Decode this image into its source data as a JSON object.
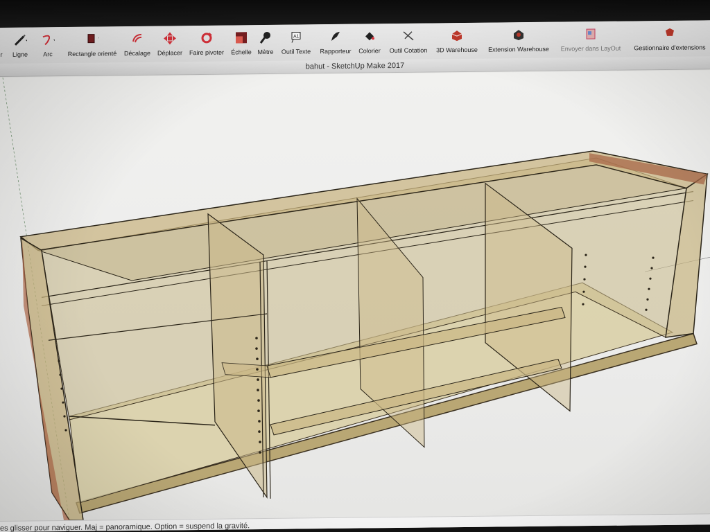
{
  "app": {
    "window_title": "bahut - SketchUp Make 2017"
  },
  "toolbar": {
    "tools": [
      {
        "id": "select",
        "label": "r",
        "icon": "select-arrow-icon"
      },
      {
        "id": "line",
        "label": "Ligne",
        "icon": "pencil-icon"
      },
      {
        "id": "arc",
        "label": "Arc",
        "icon": "arc-icon"
      },
      {
        "id": "rotated-rectangle",
        "label": "Rectangle orienté",
        "icon": "rotated-rectangle-icon"
      },
      {
        "id": "offset",
        "label": "Décalage",
        "icon": "offset-icon"
      },
      {
        "id": "move",
        "label": "Déplacer",
        "icon": "move-icon"
      },
      {
        "id": "rotate",
        "label": "Faire pivoter",
        "icon": "rotate-icon"
      },
      {
        "id": "scale",
        "label": "Échelle",
        "icon": "scale-icon"
      },
      {
        "id": "tape",
        "label": "Mètre",
        "icon": "tape-measure-icon"
      },
      {
        "id": "text",
        "label": "Outil Texte",
        "icon": "text-tool-icon"
      },
      {
        "id": "protractor",
        "label": "Rapporteur",
        "icon": "protractor-icon"
      },
      {
        "id": "paint",
        "label": "Colorier",
        "icon": "paint-bucket-icon"
      },
      {
        "id": "dimension",
        "label": "Outil Cotation",
        "icon": "dimension-icon"
      },
      {
        "id": "3d-warehouse",
        "label": "3D Warehouse",
        "icon": "3d-warehouse-icon"
      },
      {
        "id": "extension-warehouse",
        "label": "Extension Warehouse",
        "icon": "extension-warehouse-icon"
      },
      {
        "id": "send-to-layout",
        "label": "Envoyer dans LayOut",
        "icon": "layout-icon"
      },
      {
        "id": "extension-manager",
        "label": "Gestionnaire d'extensions",
        "icon": "extension-manager-icon"
      }
    ]
  },
  "status_bar": {
    "text": "es glisser pour naviguer. Maj = panoramique. Option = suspend la gravité."
  },
  "colors": {
    "accent": "#c0392b",
    "wood": "#c9b98a",
    "wood_dark": "#8a7a4e",
    "edge": "#b07050"
  }
}
